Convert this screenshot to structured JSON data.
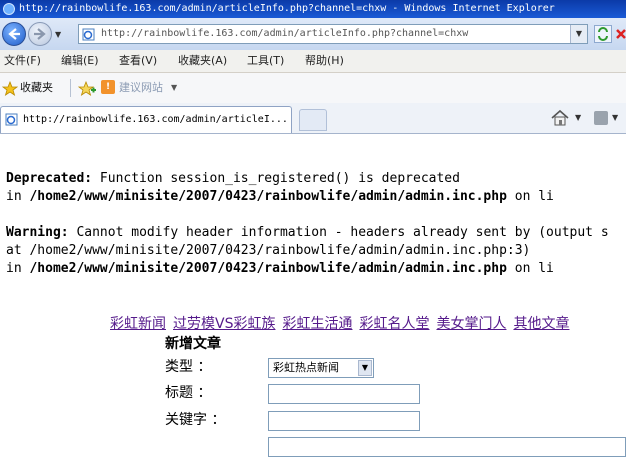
{
  "window": {
    "title": "http://rainbowlife.163.com/admin/articleInfo.php?channel=chxw - Windows Internet Explorer"
  },
  "address_bar": {
    "url": "http://rainbowlife.163.com/admin/articleInfo.php?channel=chxw"
  },
  "menu": {
    "items": [
      "文件(F)",
      "编辑(E)",
      "查看(V)",
      "收藏夹(A)",
      "工具(T)",
      "帮助(H)"
    ]
  },
  "favorites_bar": {
    "label": "收藏夹",
    "suggested_sites": "建议网站"
  },
  "tab": {
    "title": "http://rainbowlife.163.com/admin/articleI..."
  },
  "errors": {
    "deprecated_label": "Deprecated:",
    "deprecated_msg": " Function session_is_registered() is deprecated",
    "in1": "in ",
    "path1": "/home2/www/minisite/2007/0423/rainbowlife/admin/admin.inc.php",
    "online1": " on li",
    "warning_label": "Warning:",
    "warning_msg": " Cannot modify header information - headers already sent by (output s",
    "at_line": "at /home2/www/minisite/2007/0423/rainbowlife/admin/admin.inc.php:3)",
    "in2": "in ",
    "path2": "/home2/www/minisite/2007/0423/rainbowlife/admin/admin.inc.php",
    "online2": " on li"
  },
  "site_nav": {
    "links": [
      "彩虹新闻",
      "过劳模VS彩虹族",
      "彩虹生活通",
      "彩虹名人堂",
      "美女掌门人",
      "其他文章"
    ]
  },
  "form": {
    "title": "新增文章",
    "type_label": "类型 ：",
    "type_value": "彩虹热点新闻",
    "title_label": "标题 ：",
    "title_value": "",
    "keyword_label": "关键字 ：",
    "keyword_value": ""
  }
}
